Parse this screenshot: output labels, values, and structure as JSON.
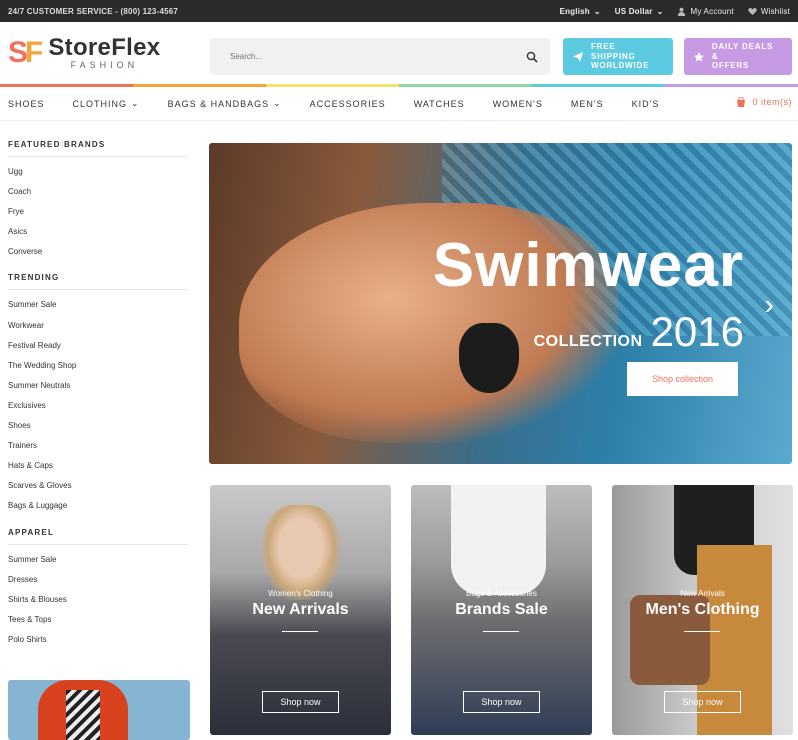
{
  "topbar": {
    "service": "24/7 CUSTOMER SERVICE - (800) 123-4567",
    "language": "English",
    "currency": "US Dollar",
    "account": "My Account",
    "wishlist": "Wishlist"
  },
  "header": {
    "logo_mark": "SF",
    "logo_title": "StoreFlex",
    "logo_sub": "FASHION",
    "search_placeholder": "Search...",
    "promo_shipping": [
      "FREE SHIPPING",
      "WORLDWIDE"
    ],
    "promo_deals": [
      "DAILY DEALS &",
      "OFFERS"
    ]
  },
  "colors": {
    "accent": "#f0705a",
    "shipping": "#5ccbe1",
    "deals": "#c79be3",
    "stripe": [
      "#f0705a",
      "#f7a53b",
      "#f7e06b",
      "#8fd6a1",
      "#5ccbe1",
      "#c79be3"
    ]
  },
  "nav": {
    "items": [
      "SHOES",
      "CLOTHING",
      "BAGS & HANDBAGS",
      "ACCESSORIES",
      "WATCHES",
      "WOMEN'S",
      "MEN'S",
      "KID'S"
    ],
    "cart": "0 item(s)"
  },
  "sidebar": {
    "featured_heading": "FEATURED BRANDS",
    "featured": [
      "Ugg",
      "Coach",
      "Frye",
      "Asics",
      "Converse"
    ],
    "trending_heading": "TRENDING",
    "trending": [
      "Summer Sale",
      "Workwear",
      "Festival Ready",
      "The Wedding Shop",
      "Summer Neutrals",
      "Exclusives",
      "Shoes",
      "Trainers",
      "Hats & Caps",
      "Scarves & Gloves",
      "Bags & Luggage"
    ],
    "apparel_heading": "APPAREL",
    "apparel": [
      "Summer Sale",
      "Dresses",
      "Shirts & Blouses",
      "Tees & Tops",
      "Polo Shirts"
    ]
  },
  "hero": {
    "title": "Swimwear",
    "collection": "COLLECTION",
    "year": "2016",
    "button": "Shop collection"
  },
  "cards": [
    {
      "sub": "Women's Clothing",
      "title": "New Arrivals",
      "button": "Shop now"
    },
    {
      "sub": "Bags & Accessories",
      "title": "Brands Sale",
      "button": "Shop now"
    },
    {
      "sub": "New Arrivals",
      "title": "Men's Clothing",
      "button": "Shop now"
    }
  ]
}
